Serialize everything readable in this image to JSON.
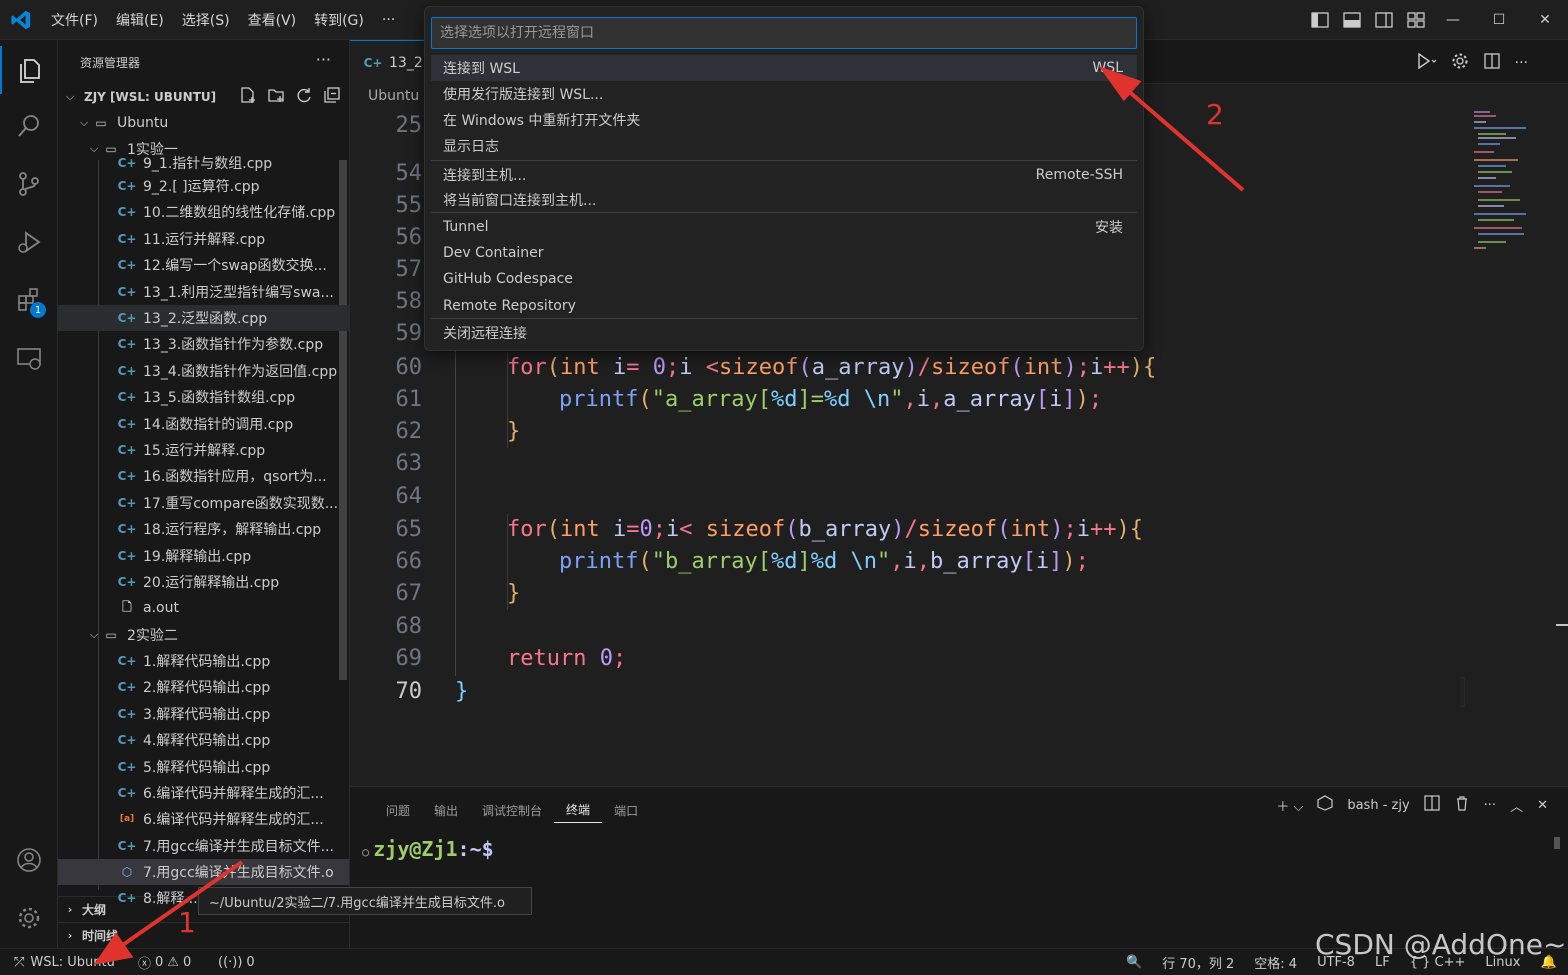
{
  "titlebar": {
    "menu": [
      "文件(F)",
      "编辑(E)",
      "选择(S)",
      "查看(V)",
      "转到(G)",
      "···"
    ],
    "window_controls": {
      "minimize": "—",
      "maximize": "☐",
      "close": "✕"
    }
  },
  "sidebar": {
    "title": "资源管理器",
    "more": "···",
    "root_label": "ZJY [WSL: UBUNTU]",
    "folder_ubuntu": "Ubuntu",
    "folder_exp1": "1实验一",
    "partial_top": "9_1.指针与数组.cpp",
    "files_exp1": [
      "9_2.[ ]运算符.cpp",
      "10.二维数组的线性化存储.cpp",
      "11.运行并解释.cpp",
      "12.编写一个swap函数交换...",
      "13_1.利用泛型指针编写swa...",
      "13_2.泛型函数.cpp",
      "13_3.函数指针作为参数.cpp",
      "13_4.函数指针作为返回值.cpp",
      "13_5.函数指针数组.cpp",
      "14.函数指针的调用.cpp",
      "15.运行并解释.cpp",
      "16.函数指针应用，qsort为...",
      "17.重写compare函数实现数...",
      "18.运行程序，解释输出.cpp",
      "19.解释输出.cpp",
      "20.运行解释输出.cpp",
      "a.out"
    ],
    "folder_exp2": "2实验二",
    "files_exp2": [
      "1.解释代码输出.cpp",
      "2.解释代码输出.cpp",
      "3.解释代码输出.cpp",
      "4.解释代码输出.cpp",
      "5.解释代码输出.cpp",
      "6.编译代码并解释生成的汇...",
      "6.编译代码并解释生成的汇...",
      "7.用gcc编译并生成目标文件...",
      "7.用gcc编译并生成目标文件.o"
    ],
    "partial_bottom": "8.解释...",
    "outline": "大纲",
    "timeline": "时间线"
  },
  "activity": {
    "extensions_badge": "1"
  },
  "tabs": {
    "active": "13_2."
  },
  "breadcrumb": "Ubuntu",
  "editor": {
    "lines": [
      {
        "n": "25",
        "code": ""
      },
      {
        "n": "54",
        "code": ""
      },
      {
        "n": "55",
        "code": ""
      },
      {
        "n": "56",
        "code": ""
      },
      {
        "n": "57",
        "code": ""
      },
      {
        "n": "58",
        "code": ""
      },
      {
        "n": "59",
        "code": ""
      },
      {
        "n": "60",
        "code": "for(int i= 0;i <sizeof(a_array)/sizeof(int);i++){"
      },
      {
        "n": "61",
        "code": "printf(\"a_array[%d]=%d \\n\",i,a_array[i]);"
      },
      {
        "n": "62",
        "code": "}"
      },
      {
        "n": "63",
        "code": ""
      },
      {
        "n": "64",
        "code": ""
      },
      {
        "n": "65",
        "code": "for(int i=0;i< sizeof(b_array)/sizeof(int);i++){"
      },
      {
        "n": "66",
        "code": "printf(\"b_array[%d]%d \\n\",i,b_array[i]);"
      },
      {
        "n": "67",
        "code": "}"
      },
      {
        "n": "68",
        "code": ""
      },
      {
        "n": "69",
        "code": "return 0;"
      },
      {
        "n": "70",
        "code": "}"
      }
    ]
  },
  "quickpick": {
    "placeholder": "选择选项以打开远程窗口",
    "items": [
      {
        "label": "连接到 WSL",
        "detail": "WSL"
      },
      {
        "label": "使用发行版连接到 WSL...",
        "detail": ""
      },
      {
        "label": "在 Windows 中重新打开文件夹",
        "detail": ""
      },
      {
        "label": "显示日志",
        "detail": ""
      },
      {
        "label": "连接到主机...",
        "detail": "Remote-SSH"
      },
      {
        "label": "将当前窗口连接到主机...",
        "detail": ""
      },
      {
        "label": "Tunnel",
        "detail": "安装"
      },
      {
        "label": "Dev Container",
        "detail": ""
      },
      {
        "label": "GitHub Codespace",
        "detail": ""
      },
      {
        "label": "Remote Repository",
        "detail": ""
      },
      {
        "label": "关闭远程连接",
        "detail": ""
      }
    ]
  },
  "panel": {
    "tabs": [
      "问题",
      "输出",
      "调试控制台",
      "终端",
      "端口"
    ],
    "active_tab": "终端",
    "terminal_name": "bash - zjy",
    "prompt_user": "zjy@Zj1",
    "prompt_path": ":~$"
  },
  "tooltip": "~/Ubuntu/2实验二/7.用gcc编译并生成目标文件.o",
  "statusbar": {
    "remote": "WSL: Ubuntu",
    "errors": "0",
    "warnings": "0",
    "ports": "0",
    "position": "行 70，列 2",
    "spaces": "空格: 4",
    "encoding": "UTF-8",
    "eol": "LF",
    "language": "C++",
    "os": "Linux"
  },
  "annotations": {
    "label1": "1",
    "label2": "2"
  },
  "watermark": "CSDN @AddOne~",
  "colors": {
    "accent": "#0078d4",
    "annotation": "#e0332e",
    "focused_item": "#04395e"
  }
}
